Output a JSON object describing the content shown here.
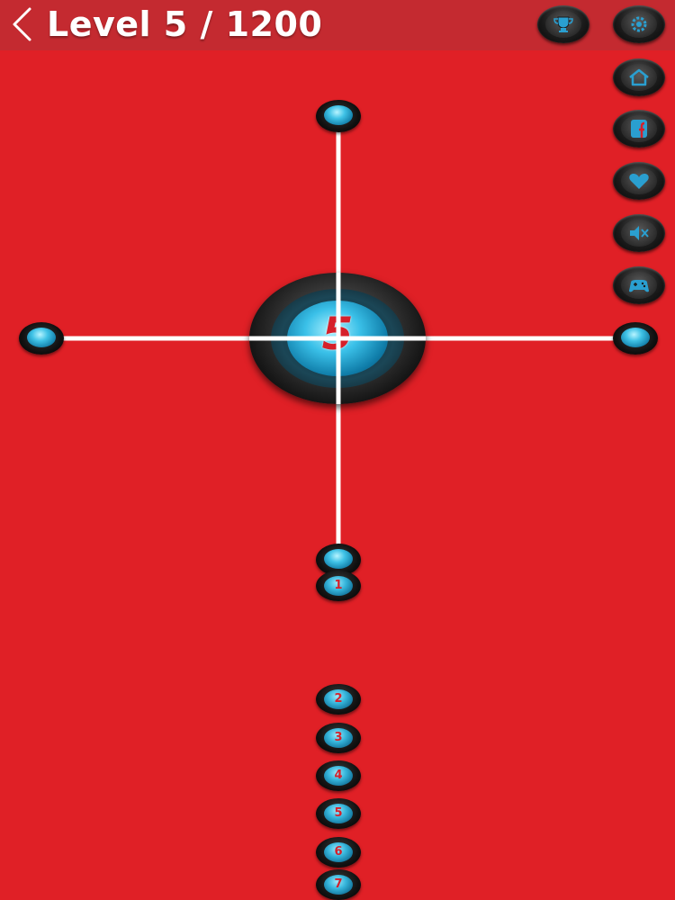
{
  "header": {
    "title": "Level 5 / 1200",
    "icons": [
      "back-chevron-icon",
      "trophy-icon",
      "gear-icon"
    ]
  },
  "side_menu": {
    "icons": [
      "home-icon",
      "facebook-icon",
      "heart-icon",
      "mute-icon",
      "gamepad-icon"
    ]
  },
  "board": {
    "hub_number": "5",
    "colors": {
      "background": "#e02026",
      "header": "#c42a30",
      "line": "#ffffff",
      "gem": "#3fc2e6",
      "number": "#d6202a"
    }
  },
  "tray": {
    "tokens": [
      "1",
      "2",
      "3",
      "4",
      "5",
      "6",
      "7"
    ]
  }
}
